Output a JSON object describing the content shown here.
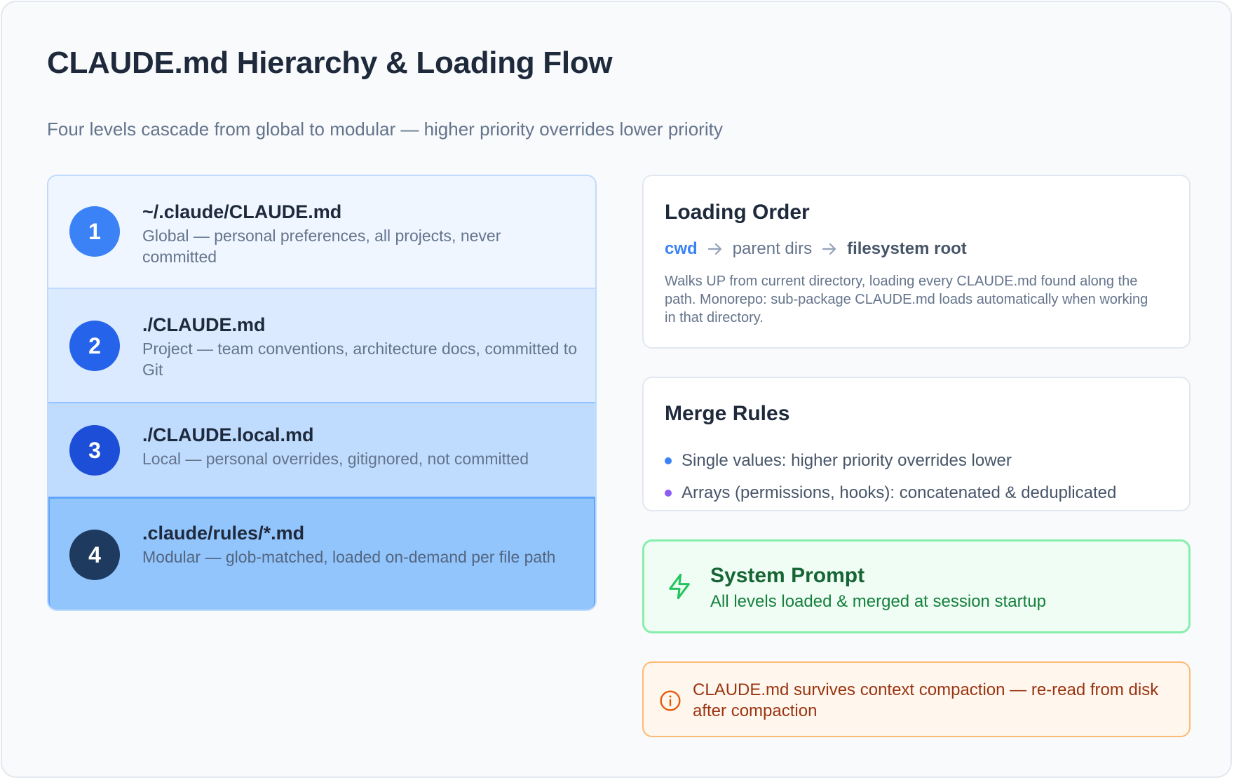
{
  "header": {
    "title": "CLAUDE.md Hierarchy & Loading Flow",
    "subtitle": "Four levels cascade from global to modular — higher priority overrides lower priority"
  },
  "levels": [
    {
      "number": "1",
      "name": "~/.claude/CLAUDE.md",
      "description": "Global — personal preferences, all projects, never committed",
      "color": "#3b82f6"
    },
    {
      "number": "2",
      "name": "./CLAUDE.md",
      "description": "Project — team conventions, architecture docs, committed to Git",
      "color": "#2563eb"
    },
    {
      "number": "3",
      "name": "./CLAUDE.local.md",
      "description": "Local — personal overrides, gitignored, not committed",
      "color": "#1d4ed8"
    },
    {
      "number": "4",
      "name": ".claude/rules/*.md",
      "description": "Modular — glob-matched, loaded on-demand per file path",
      "color": "#1e3a5f"
    }
  ],
  "loading_order": {
    "title": "Loading Order",
    "path": [
      "cwd",
      "parent dirs",
      "filesystem root"
    ],
    "description": "Walks UP from current directory, loading every CLAUDE.md found along the path. Monorepo: sub-package CLAUDE.md loads automatically when working in that directory."
  },
  "merge_rules": {
    "title": "Merge Rules",
    "rules": [
      {
        "text": "Single values: higher priority overrides lower",
        "dot_color": "#3b82f6"
      },
      {
        "text": "Arrays (permissions, hooks): concatenated & deduplicated",
        "dot_color": "#8b5cf6"
      }
    ]
  },
  "system_prompt": {
    "icon": "lightning-bolt-icon",
    "title": "System Prompt",
    "description": "All levels loaded & merged at session startup"
  },
  "note": {
    "icon": "info-icon",
    "text": "CLAUDE.md survives context compaction — re-read from disk after compaction"
  }
}
